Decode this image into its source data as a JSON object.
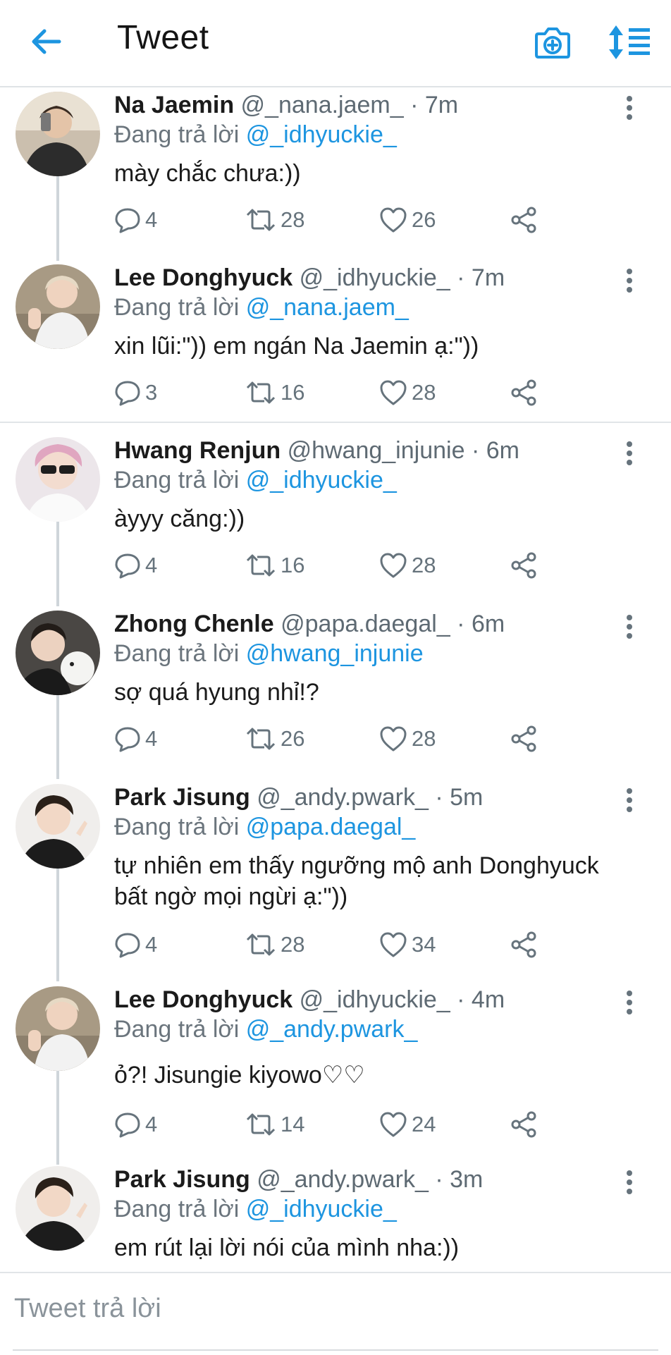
{
  "header": {
    "title": "Tweet",
    "back_icon": "arrow-left-icon",
    "camera_icon": "camera-plus-icon",
    "sort_icon": "sort-list-icon"
  },
  "colors": {
    "accent": "#1d95e0",
    "text": "#1b1b1b",
    "muted": "#66737c",
    "divider": "#e1e5e8"
  },
  "tweets": [
    {
      "name": "Na Jaemin",
      "handle": "@_nana.jaem_",
      "time": "· 7m",
      "reply_prefix": "Đang trả lời",
      "reply_to": "@_idhyuckie_",
      "text": "mày chắc chưa:))",
      "replies": "4",
      "retweets": "28",
      "likes": "26"
    },
    {
      "name": "Lee Donghyuck",
      "handle": "@_idhyuckie_",
      "time": "· 7m",
      "reply_prefix": "Đang trả lời",
      "reply_to": "@_nana.jaem_",
      "text": "xin lũi:\")) em ngán Na Jaemin ạ:\"))",
      "replies": "3",
      "retweets": "16",
      "likes": "28"
    },
    {
      "name": "Hwang Renjun",
      "handle": "@hwang_injunie",
      "time": "· 6m",
      "reply_prefix": "Đang trả lời",
      "reply_to": "@_idhyuckie_",
      "text": "àyyy căng:))",
      "replies": "4",
      "retweets": "16",
      "likes": "28"
    },
    {
      "name": "Zhong Chenle",
      "handle": "@papa.daegal_",
      "time": "· 6m",
      "reply_prefix": "Đang trả lời",
      "reply_to": "@hwang_injunie",
      "text": "sợ quá hyung nhỉ!?",
      "replies": "4",
      "retweets": "26",
      "likes": "28"
    },
    {
      "name": "Park Jisung",
      "handle": "@_andy.pwark_",
      "time": "· 5m",
      "reply_prefix": "Đang trả lời",
      "reply_to": "@papa.daegal_",
      "text": "tự nhiên em thấy ngưỡng mộ anh Donghyuck bất ngờ mọi ngừi ạ:\"))",
      "replies": "4",
      "retweets": "28",
      "likes": "34"
    },
    {
      "name": "Lee Donghyuck",
      "handle": "@_idhyuckie_",
      "time": "· 4m",
      "reply_prefix": "Đang trả lời",
      "reply_to": "@_andy.pwark_",
      "text": "ỏ?! Jisungie kiyowo♡♡",
      "replies": "4",
      "retweets": "14",
      "likes": "24"
    },
    {
      "name": "Park Jisung",
      "handle": "@_andy.pwark_",
      "time": "· 3m",
      "reply_prefix": "Đang trả lời",
      "reply_to": "@_idhyuckie_",
      "text": "em rút lại lời nói của mình nha:))"
    }
  ],
  "compose": {
    "placeholder": "Tweet trả lời"
  }
}
